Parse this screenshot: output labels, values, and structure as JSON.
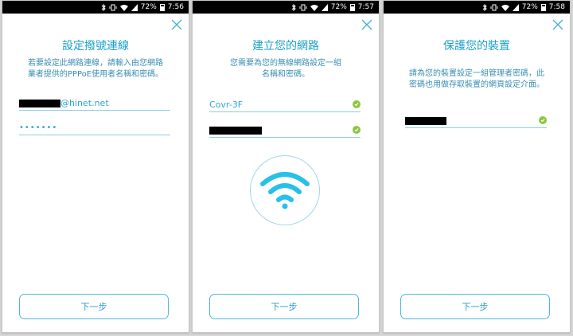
{
  "status_bars": [
    {
      "percent": "72%",
      "time": "7:56"
    },
    {
      "percent": "72%",
      "time": "7:57"
    },
    {
      "percent": "72%",
      "time": "7:58"
    }
  ],
  "screens": [
    {
      "title": "設定撥號連線",
      "description_line1": "若要設定此網路連線，請輸入由您網路",
      "description_line2": "業者提供的PPPoE使用者名稱和密碼。",
      "username_suffix": "@hinet.net",
      "password_mask": "•••••••",
      "next_label": "下一步"
    },
    {
      "title": "建立您的網路",
      "description_line1": "您需要為您的無線網路設定一組",
      "description_line2": "名稱和密碼。",
      "network_name": "Covr-3F",
      "next_label": "下一步"
    },
    {
      "title": "保護您的裝置",
      "description_line1": "請為您的裝置設定一組管理者密碼，此",
      "description_line2": "密碼也用做存取裝置的網頁設定介面。",
      "next_label": "下一步"
    }
  ],
  "colors": {
    "accent": "#1aa0c8",
    "check": "#8cc63f",
    "wifi": "#27c0ea"
  },
  "icons": [
    "close-icon",
    "check-icon",
    "wifi-icon",
    "bluetooth-icon",
    "vibrate-icon",
    "wifi-signal-icon",
    "cell-signal-icon",
    "battery-icon"
  ]
}
